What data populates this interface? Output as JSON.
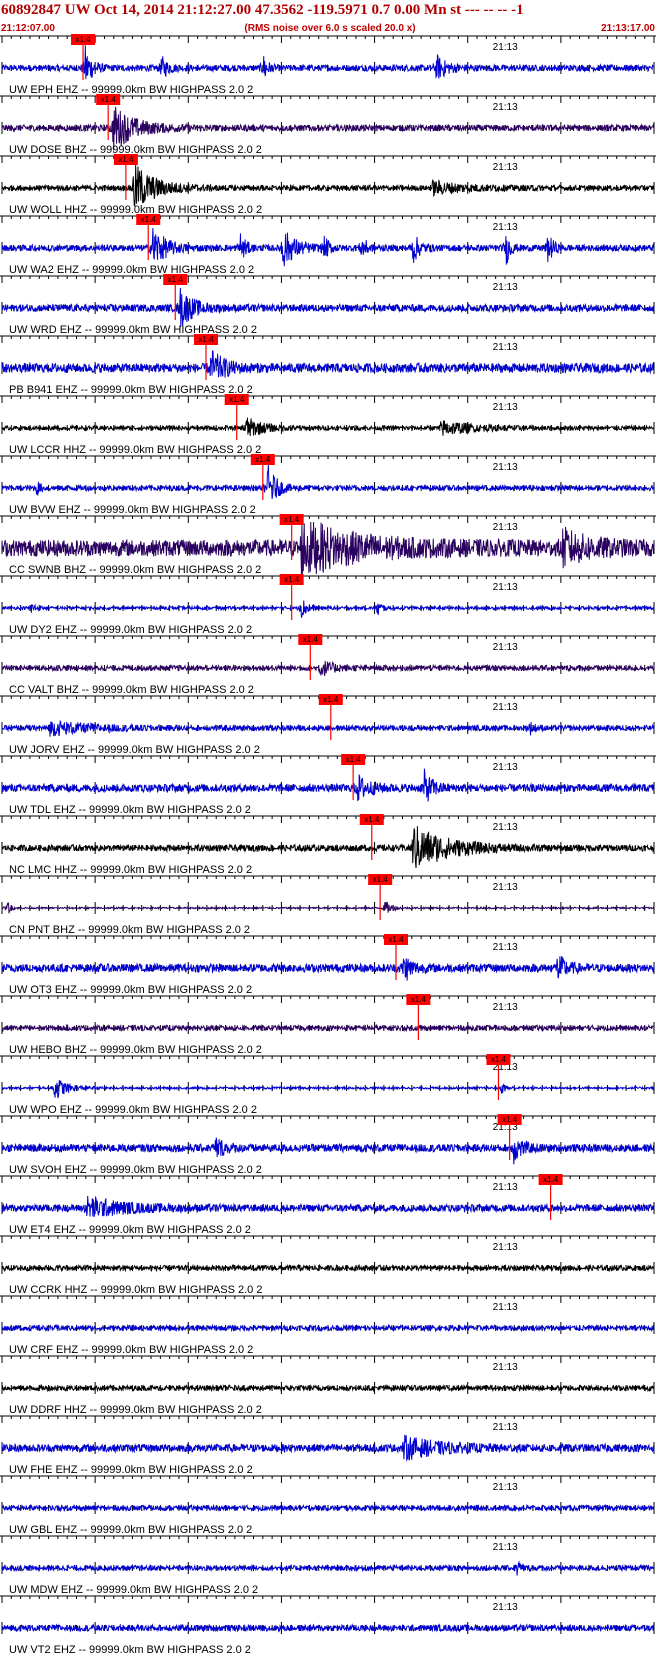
{
  "header": {
    "title": "60892847 UW Oct 14, 2014 21:12:27.00   47.3562 -119.5971  0.7 0.00 Mn st --- -- --  -1",
    "start_time": "21:12:07.00",
    "noise_note": "(RMS noise over 6.0 s scaled 20.0 x)",
    "end_time": "21:13:17.00"
  },
  "colors": {
    "blue": "#0000d0",
    "purple": "#2a0060",
    "black": "#000000",
    "pick": "#ff0000",
    "header": "#c00000"
  },
  "chart_data": {
    "type": "line",
    "title": "60892847 UW Oct 14, 2014 21:12:27.00   47.3562 -119.5971  0.7 0.00 Mn st --- -- --  -1",
    "x_range": [
      "21:12:07.00",
      "21:13:17.00"
    ],
    "minute_marker": "21:13",
    "pick_label": "x1.4",
    "grid": true,
    "traces": [
      {
        "label": "UW EPH  EHZ -- 99999.0km BW  HIGHPASS  2.0  2",
        "color": "blue",
        "pick_s": 8.7,
        "events": [
          {
            "t": 8.8,
            "a": 1.0,
            "w": 1.5
          },
          {
            "t": 17.0,
            "a": 0.5,
            "w": 1.5
          },
          {
            "t": 28.0,
            "a": 0.9,
            "w": 0.8
          },
          {
            "t": 46.5,
            "a": 0.5,
            "w": 2.5
          }
        ],
        "noise": 0.12
      },
      {
        "label": "UW DOSE BHZ -- 99999.0km BW  HIGHPASS  2.0  2",
        "color": "purple",
        "pick_s": 11.4,
        "events": [
          {
            "t": 11.8,
            "a": 0.9,
            "w": 5
          }
        ],
        "noise": 0.12
      },
      {
        "label": "UW WOLL HHZ -- 99999.0km BW  HIGHPASS  2.0  2",
        "color": "black",
        "pick_s": 13.3,
        "events": [
          {
            "t": 14.0,
            "a": 1.0,
            "w": 5
          },
          {
            "t": 46.0,
            "a": 0.25,
            "w": 8
          }
        ],
        "noise": 0.1
      },
      {
        "label": "UW WA2  EHZ -- 99999.0km BW  HIGHPASS  2.0  2",
        "color": "blue",
        "pick_s": 15.7,
        "events": [
          {
            "t": 16.0,
            "a": 0.9,
            "w": 3
          },
          {
            "t": 25.5,
            "a": 1.0,
            "w": 1
          },
          {
            "t": 30.0,
            "a": 0.8,
            "w": 3
          },
          {
            "t": 34.5,
            "a": 0.6,
            "w": 1
          },
          {
            "t": 38.5,
            "a": 0.7,
            "w": 1
          },
          {
            "t": 44.0,
            "a": 0.7,
            "w": 1.5
          },
          {
            "t": 54.0,
            "a": 0.8,
            "w": 1
          },
          {
            "t": 58.5,
            "a": 0.9,
            "w": 1
          }
        ],
        "noise": 0.12
      },
      {
        "label": "UW WRD  EHZ -- 99999.0km BW  HIGHPASS  2.0  2",
        "color": "blue",
        "pick_s": 18.6,
        "events": [
          {
            "t": 19.0,
            "a": 0.8,
            "w": 3
          }
        ],
        "noise": 0.14
      },
      {
        "label": "PB B941 EHZ -- 99999.0km BW  HIGHPASS  2.0  2",
        "color": "blue",
        "pick_s": 21.9,
        "events": [
          {
            "t": 22.3,
            "a": 0.7,
            "w": 3
          }
        ],
        "noise": 0.18
      },
      {
        "label": "UW LCCR HHZ -- 99999.0km BW  HIGHPASS  2.0  2",
        "color": "black",
        "pick_s": 25.2,
        "events": [
          {
            "t": 26.0,
            "a": 0.45,
            "w": 4
          },
          {
            "t": 47.0,
            "a": 0.3,
            "w": 7
          }
        ],
        "noise": 0.08
      },
      {
        "label": "UW BVW  EHZ -- 99999.0km BW  HIGHPASS  2.0  2",
        "color": "blue",
        "pick_s": 28.0,
        "events": [
          {
            "t": 3.6,
            "a": 0.4,
            "w": 0.8
          },
          {
            "t": 28.4,
            "a": 1.0,
            "w": 2
          }
        ],
        "noise": 0.1
      },
      {
        "label": "CC SWNB BHZ -- 99999.0km BW  HIGHPASS  2.0  2",
        "color": "purple",
        "pick_s": 31.1,
        "events": [
          {
            "t": 32.0,
            "a": 1.0,
            "w": 12
          },
          {
            "t": 60.0,
            "a": 0.6,
            "w": 6
          }
        ],
        "noise": 0.32
      },
      {
        "label": "UW DY2  EHZ -- 99999.0km BW  HIGHPASS  2.0  2",
        "color": "blue",
        "pick_s": 31.1,
        "events": [
          {
            "t": 3.0,
            "a": 0.3,
            "w": 1
          },
          {
            "t": 32.0,
            "a": 0.5,
            "w": 1.5
          },
          {
            "t": 40.2,
            "a": 0.5,
            "w": 0.8
          }
        ],
        "noise": 0.06
      },
      {
        "label": "CC VALT BHZ -- 99999.0km BW  HIGHPASS  2.0  2",
        "color": "purple",
        "pick_s": 33.1,
        "events": [
          {
            "t": 34.0,
            "a": 0.35,
            "w": 3
          }
        ],
        "noise": 0.1
      },
      {
        "label": "UW JORV EHZ -- 99999.0km BW  HIGHPASS  2.0  2",
        "color": "blue",
        "pick_s": 35.3,
        "events": [
          {
            "t": 5.0,
            "a": 0.25,
            "w": 10
          },
          {
            "t": 56.5,
            "a": 0.3,
            "w": 1.2
          }
        ],
        "noise": 0.1
      },
      {
        "label": "UW TDL  EHZ -- 99999.0km BW  HIGHPASS  2.0  2",
        "color": "blue",
        "pick_s": 37.7,
        "events": [
          {
            "t": 38.0,
            "a": 0.5,
            "w": 3
          },
          {
            "t": 45.2,
            "a": 0.7,
            "w": 2
          }
        ],
        "noise": 0.15
      },
      {
        "label": "NC LMC  HHZ -- 99999.0km BW  HIGHPASS  2.0  2",
        "color": "black",
        "pick_s": 39.7,
        "events": [
          {
            "t": 44.0,
            "a": 0.9,
            "w": 8
          }
        ],
        "noise": 0.12
      },
      {
        "label": "CN PNT  BHZ -- 99999.0km BW  HIGHPASS  2.0  2",
        "color": "purple",
        "pick_s": 40.6,
        "events": [
          {
            "t": 0.5,
            "a": 0.5,
            "w": 0.6
          },
          {
            "t": 41.0,
            "a": 0.35,
            "w": 1.5
          }
        ],
        "noise": 0.03
      },
      {
        "label": "UW OT3  EHZ -- 99999.0km BW  HIGHPASS  2.0  2",
        "color": "blue",
        "pick_s": 42.3,
        "events": [
          {
            "t": 43.0,
            "a": 0.6,
            "w": 2
          },
          {
            "t": 59.5,
            "a": 0.6,
            "w": 2
          }
        ],
        "noise": 0.16
      },
      {
        "label": "UW HEBO BHZ -- 99999.0km BW  HIGHPASS  2.0  2",
        "color": "purple",
        "pick_s": 44.7,
        "events": [],
        "noise": 0.1
      },
      {
        "label": "UW WPO  EHZ -- 99999.0km BW  HIGHPASS  2.0  2",
        "color": "blue",
        "pick_s": 53.3,
        "events": [
          {
            "t": 5.5,
            "a": 0.5,
            "w": 3
          },
          {
            "t": 53.5,
            "a": 0.3,
            "w": 1
          }
        ],
        "noise": 0.04
      },
      {
        "label": "UW SVOH EHZ -- 99999.0km BW  HIGHPASS  2.0  2",
        "color": "blue",
        "pick_s": 54.5,
        "events": [
          {
            "t": 22.8,
            "a": 0.45,
            "w": 2
          },
          {
            "t": 54.8,
            "a": 0.6,
            "w": 2
          }
        ],
        "noise": 0.15
      },
      {
        "label": "UW ET4  EHZ -- 99999.0km BW  HIGHPASS  2.0  2",
        "color": "blue",
        "pick_s": 58.9,
        "events": [
          {
            "t": 9.0,
            "a": 0.4,
            "w": 8
          }
        ],
        "noise": 0.14
      },
      {
        "label": "UW CCRK HHZ -- 99999.0km BW  HIGHPASS  2.0  2",
        "color": "black",
        "pick_s": null,
        "events": [],
        "noise": 0.1
      },
      {
        "label": "UW CRF  EHZ -- 99999.0km BW  HIGHPASS  2.0  2",
        "color": "blue",
        "pick_s": null,
        "events": [],
        "noise": 0.1
      },
      {
        "label": "UW DDRF HHZ -- 99999.0km BW  HIGHPASS  2.0  2",
        "color": "black",
        "pick_s": null,
        "events": [],
        "noise": 0.1
      },
      {
        "label": "UW FHE  EHZ -- 99999.0km BW  HIGHPASS  2.0  2",
        "color": "blue",
        "pick_s": null,
        "events": [
          {
            "t": 43.0,
            "a": 0.4,
            "w": 8
          }
        ],
        "noise": 0.15
      },
      {
        "label": "UW GBL  EHZ -- 99999.0km BW  HIGHPASS  2.0  2",
        "color": "blue",
        "pick_s": null,
        "events": [],
        "noise": 0.1
      },
      {
        "label": "UW MDW  EHZ -- 99999.0km BW  HIGHPASS  2.0  2",
        "color": "blue",
        "pick_s": null,
        "events": [
          {
            "t": 55.2,
            "a": 0.5,
            "w": 0.8
          }
        ],
        "noise": 0.1
      },
      {
        "label": "UW VT2  EHZ -- 99999.0km BW  HIGHPASS  2.0  2",
        "color": "blue",
        "pick_s": null,
        "events": [],
        "noise": 0.12
      }
    ]
  }
}
